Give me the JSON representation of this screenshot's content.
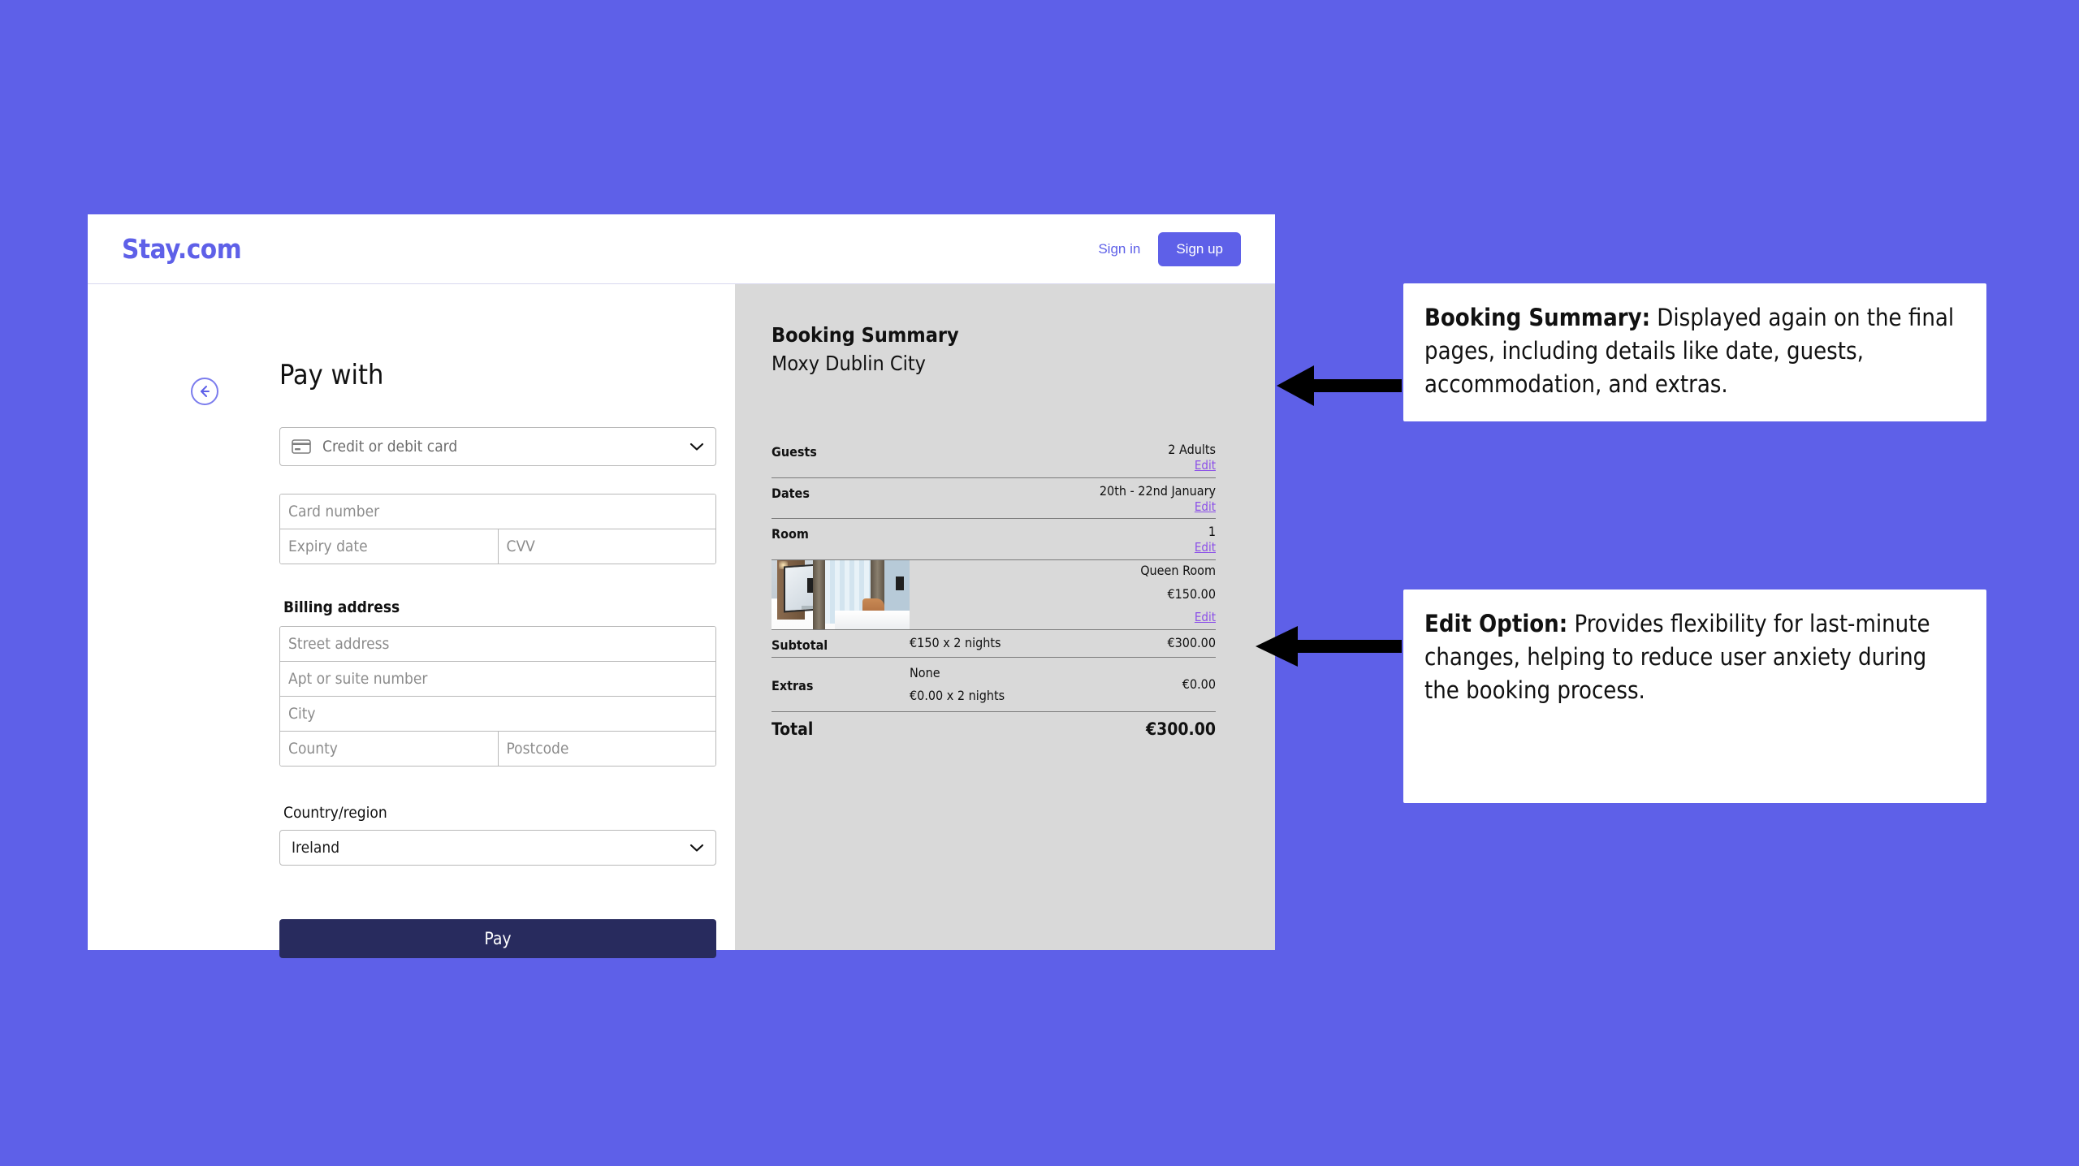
{
  "colors": {
    "background": "#5e60e8",
    "brand": "#5e60e8",
    "summary_panel": "#d9d9d9",
    "pay_button": "#282b5e",
    "edit_link": "#8b4fe8"
  },
  "header": {
    "brand": "Stay.com",
    "sign_in": "Sign in",
    "sign_up": "Sign up"
  },
  "payment": {
    "title": "Pay with",
    "back_icon": "arrow-left-circle-icon",
    "method": {
      "icon": "credit-card-icon",
      "value": "Credit or debit card",
      "chevron": "chevron-down-icon"
    },
    "card_fields": {
      "card_number": "Card number",
      "expiry_date": "Expiry date",
      "cvv": "CVV"
    },
    "billing_address_label": "Billing address",
    "address_fields": {
      "street": "Street address",
      "apt": "Apt or suite number",
      "city": "City",
      "county": "County",
      "postcode": "Postcode"
    },
    "country_label": "Country/region",
    "country_value": "Ireland",
    "pay_button": "Pay"
  },
  "summary": {
    "title": "Booking Summary",
    "hotel": "Moxy Dublin City",
    "edit_label": "Edit",
    "rows": {
      "guests": {
        "label": "Guests",
        "value": "2 Adults"
      },
      "dates": {
        "label": "Dates",
        "value": "20th - 22nd January"
      },
      "room": {
        "label": "Room",
        "value": "1"
      },
      "room_detail": {
        "name": "Queen Room",
        "price": "€150.00",
        "image": "hotel-room-photo"
      },
      "subtotal": {
        "label": "Subtotal",
        "calc": "€150 x 2 nights",
        "value": "€300.00"
      },
      "extras": {
        "label": "Extras",
        "name": "None",
        "calc": "€0.00 x 2 nights",
        "value": "€0.00"
      },
      "total": {
        "label": "Total",
        "value": "€300.00"
      }
    }
  },
  "annotations": [
    {
      "title": "Booking Summary:",
      "body": " Displayed again on the final pages, including details like date, guests, accommodation, and extras."
    },
    {
      "title": "Edit Option:",
      "body": " Provides flexibility for last-minute changes, helping to reduce user anxiety during the booking process."
    }
  ]
}
